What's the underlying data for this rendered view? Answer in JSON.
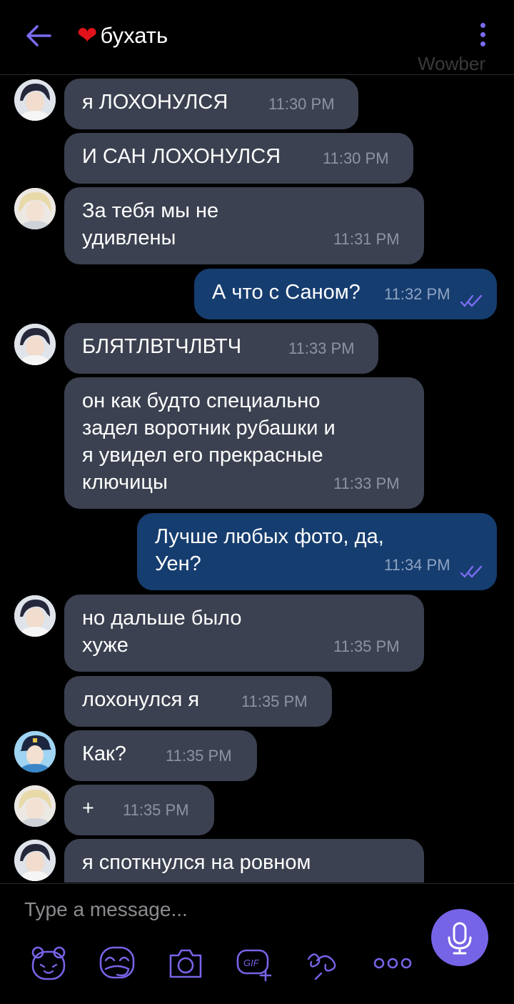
{
  "header": {
    "back_label": "back",
    "title_emoji": "❤",
    "title": "бухать",
    "watermark": "Wowber"
  },
  "messages": [
    {
      "id": 1,
      "dir": "in",
      "text": "я ЛОХОНУЛСЯ",
      "time": "11:30 PM",
      "avatar": "dark-hair"
    },
    {
      "id": 2,
      "dir": "in",
      "text": "И САН ЛОХОНУЛСЯ",
      "time": "11:30 PM",
      "avatar": ""
    },
    {
      "id": 3,
      "dir": "in",
      "text": "За тебя мы не\nудивлены",
      "time": "11:31 PM",
      "avatar": "blond"
    },
    {
      "id": 4,
      "dir": "out",
      "text": "А что с Саном?",
      "time": "11:32 PM"
    },
    {
      "id": 5,
      "dir": "in",
      "text": "БЛЯТЛВТЧЛВТЧ",
      "time": "11:33 PM",
      "avatar": "dark-hair"
    },
    {
      "id": 6,
      "dir": "in",
      "text": "он как будто специально\nзадел воротник рубашки и\nя увидел его прекрасные\nключицы",
      "time": "11:33 PM",
      "avatar": ""
    },
    {
      "id": 7,
      "dir": "out",
      "text": "Лучше любых фото, да,\nУен?",
      "time": "11:34 PM"
    },
    {
      "id": 8,
      "dir": "in",
      "text": "но дальше было\nхуже",
      "time": "11:35 PM",
      "avatar": "dark-hair"
    },
    {
      "id": 9,
      "dir": "in",
      "text": "лохонулся я",
      "time": "11:35 PM",
      "avatar": ""
    },
    {
      "id": 10,
      "dir": "in",
      "text": "Как?",
      "time": "11:35 PM",
      "avatar": "police-cap"
    },
    {
      "id": 11,
      "dir": "in",
      "text": "+",
      "time": "11:35 PM",
      "avatar": "blond"
    },
    {
      "id": 12,
      "dir": "in",
      "text": "я  споткнулся на ровном",
      "time": "",
      "avatar": "dark-hair"
    }
  ],
  "composer": {
    "placeholder": "Type a message...",
    "tools": [
      "sticker-bear-icon",
      "sticker-icon",
      "camera-icon",
      "gif-icon",
      "doodle-icon",
      "more-icon"
    ]
  },
  "colors": {
    "incoming": "#3b4150",
    "outgoing": "#163d6f",
    "accent": "#7564e6",
    "heart": "#e1121a"
  }
}
